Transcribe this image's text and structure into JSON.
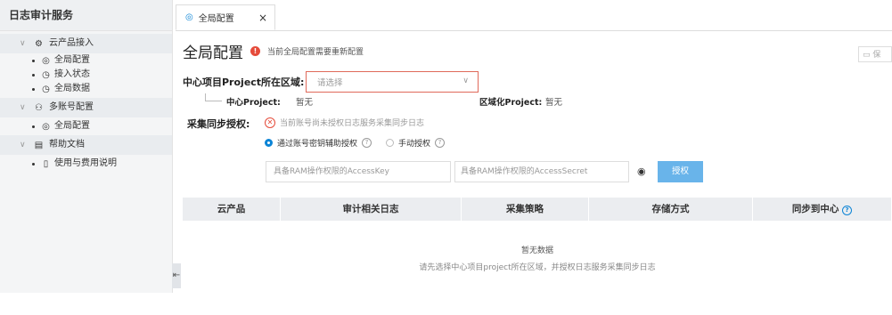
{
  "sidebar": {
    "title": "日志审计服务",
    "groups": [
      {
        "label": "云产品接入",
        "items": [
          "全局配置",
          "接入状态",
          "全局数据"
        ]
      },
      {
        "label": "多账号配置",
        "items": [
          "全局配置"
        ]
      },
      {
        "label": "帮助文档",
        "items": [
          "使用与费用说明"
        ]
      }
    ]
  },
  "tab": {
    "label": "全局配置",
    "close": "×"
  },
  "header": {
    "title": "全局配置",
    "warning": "当前全局配置需要重新配置",
    "save": "保"
  },
  "region": {
    "label": "中心项目Project所在区域:",
    "placeholder": "请选择",
    "center_project_label": "中心Project:",
    "center_project_value": "暂无",
    "regional_project_label": "区域化Project:",
    "regional_project_value": "暂无"
  },
  "sync": {
    "label": "采集同步授权:",
    "status": "当前账号尚未授权日志服务采集同步日志",
    "option_key": "通过账号密钥辅助授权",
    "option_manual": "手动授权",
    "access_key_placeholder": "具备RAM操作权限的AccessKey",
    "access_secret_placeholder": "具备RAM操作权限的AccessSecret",
    "authorize_button": "授权"
  },
  "table": {
    "columns": [
      "云产品",
      "审计相关日志",
      "采集策略",
      "存储方式",
      "同步到中心"
    ],
    "empty_title": "暂无数据",
    "empty_desc": "请先选择中心项目project所在区域，并授权日志服务采集同步日志"
  },
  "colors": {
    "accent": "#0b84d6",
    "error": "#e54b3a",
    "button": "#69b4ea"
  }
}
